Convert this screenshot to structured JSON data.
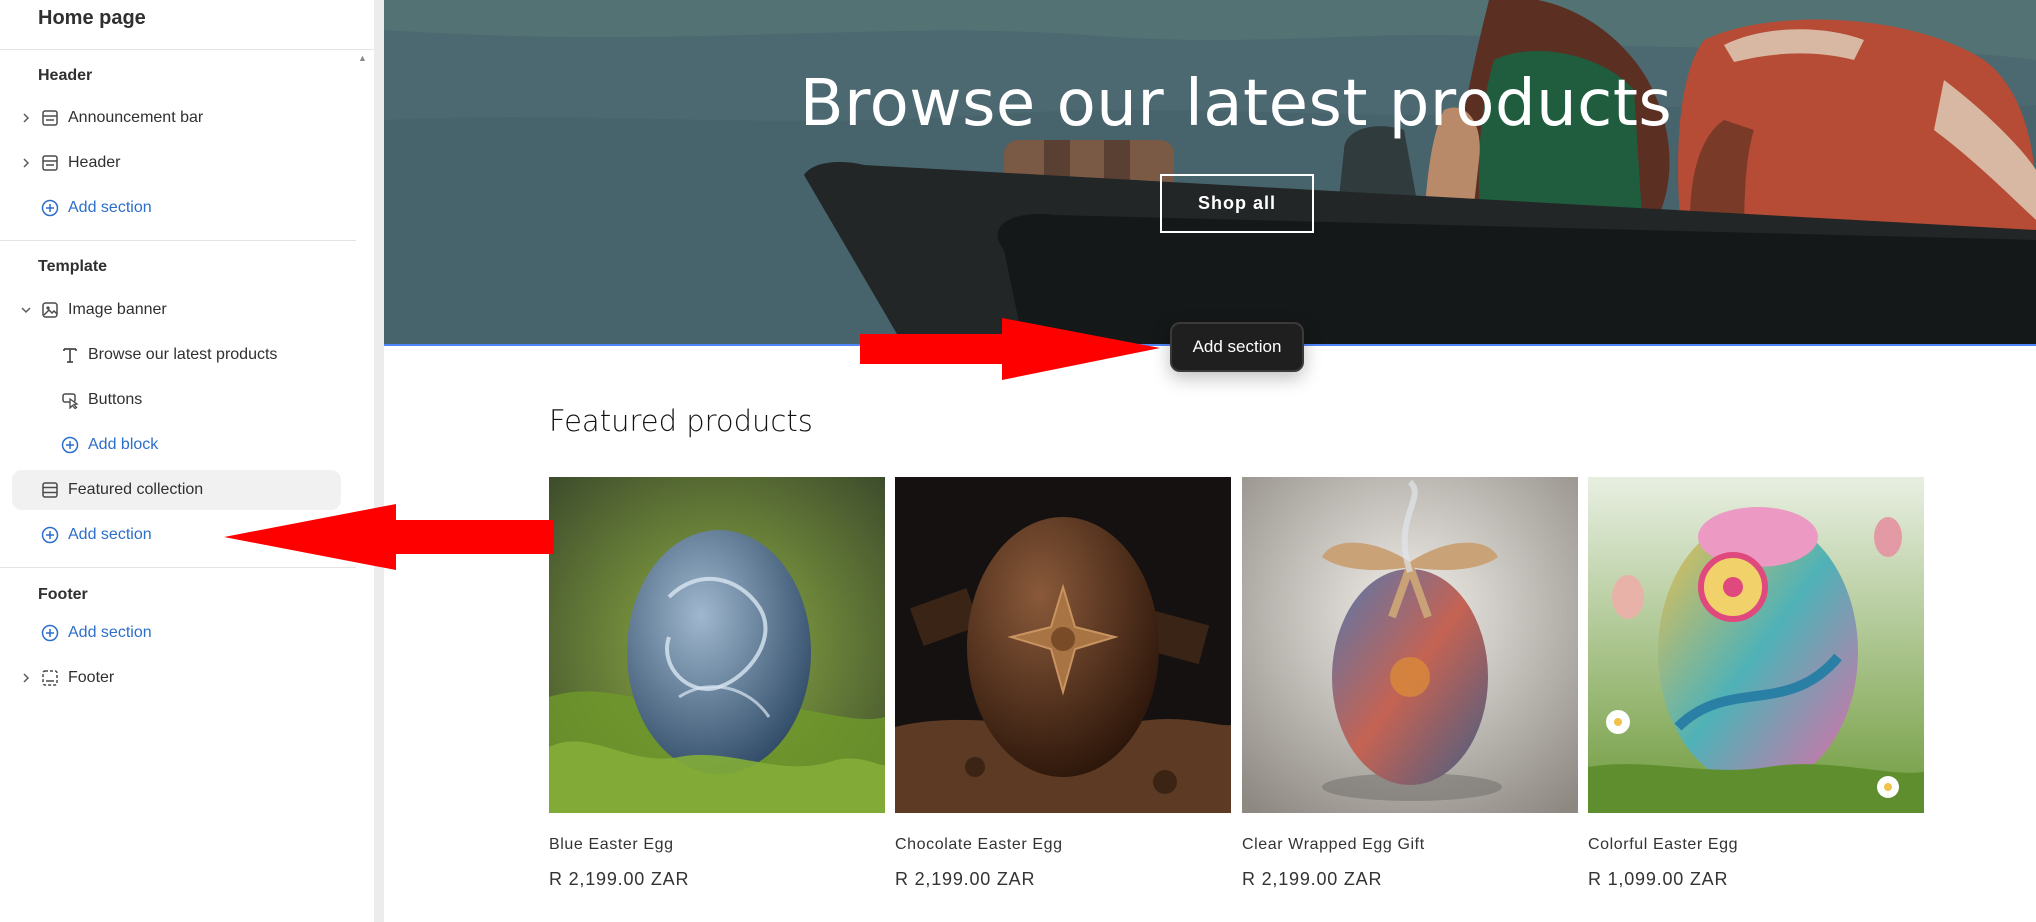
{
  "sidebar": {
    "page_title": "Home page",
    "groups": [
      {
        "title": "Header"
      },
      {
        "title": "Template"
      },
      {
        "title": "Footer"
      }
    ],
    "header_items": [
      {
        "label": "Announcement bar",
        "icon": "layout-section-icon"
      },
      {
        "label": "Header",
        "icon": "layout-section-icon"
      }
    ],
    "add_section_label": "Add section",
    "template_items": {
      "image_banner": "Image banner",
      "banner_text_block": "Browse our latest products",
      "banner_buttons_block": "Buttons",
      "add_block": "Add block",
      "featured_collection": "Featured collection"
    },
    "footer_item": "Footer"
  },
  "preview": {
    "banner": {
      "title": "Browse our latest products",
      "button_label": "Shop all"
    },
    "add_section_pill": "Add section",
    "featured": {
      "heading": "Featured products",
      "products": [
        {
          "name": "Blue Easter Egg",
          "price": "R 2,199.00 ZAR"
        },
        {
          "name": "Chocolate Easter Egg",
          "price": "R 2,199.00 ZAR"
        },
        {
          "name": "Clear Wrapped Egg Gift",
          "price": "R 2,199.00 ZAR"
        },
        {
          "name": "Colorful Easter Egg",
          "price": "R 1,099.00 ZAR"
        }
      ]
    }
  },
  "colors": {
    "link_blue": "#2c6ecb",
    "banner_bg": "#4d6a72",
    "annotation_arrow": "#ff0000",
    "selection_line": "#4f86f7"
  }
}
